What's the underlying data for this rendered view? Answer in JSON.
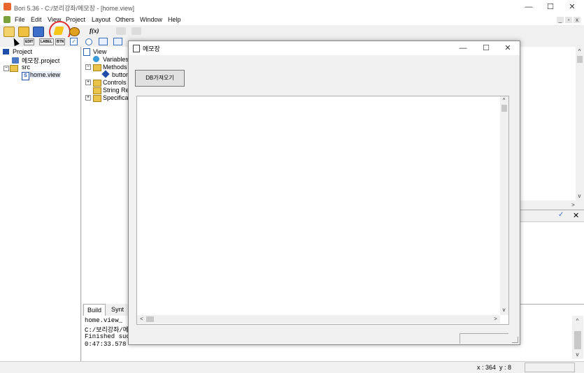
{
  "window": {
    "title": "Bori 5.36 - C:/보리강좌/메모장 - [home.view]",
    "minimize_glyph": "—",
    "maximize_glyph": "☐",
    "close_glyph": "✕"
  },
  "menu": {
    "items": [
      "File",
      "Edit",
      "View",
      "Project",
      "Layout",
      "Others",
      "Window",
      "Help"
    ],
    "mdi_minimize": "_",
    "mdi_restore": "▫",
    "mdi_close": "x"
  },
  "toolbar1": {
    "function_label": "f(x)"
  },
  "toolbar2": {
    "edit_label": "EDIT",
    "label_label": "LABEL",
    "btn_label": "BTN"
  },
  "project_tree": {
    "root": "Project",
    "project_file": "메모장.project",
    "src": "src",
    "view_file": "home.view"
  },
  "view_tree": {
    "root": "View",
    "variables": "Variables",
    "methods": "Methods",
    "button_method": "button",
    "controls": "Controls",
    "string_resources": "String Res",
    "specification": "Specificat"
  },
  "bottom": {
    "tabs": [
      "Build",
      "Synt"
    ],
    "log": [
      "home.view_",
      "C:/보리강좌/메",
      "Finished succ",
      "0:47:33.578"
    ]
  },
  "status": {
    "coords": "x : 364  y : 8"
  },
  "dialog": {
    "title": "메모장",
    "button_label": "DB가져오기",
    "minimize_glyph": "—",
    "maximize_glyph": "☐",
    "close_glyph": "✕"
  },
  "colors": {
    "accent_red": "#e03030",
    "folder_yellow": "#e9c34a",
    "project_blue": "#1f4fa8"
  }
}
